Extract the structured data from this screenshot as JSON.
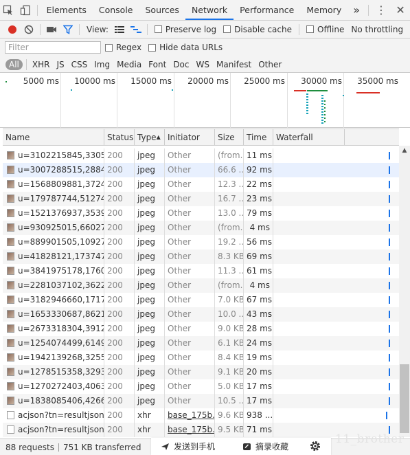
{
  "tabs": [
    "Elements",
    "Console",
    "Sources",
    "Network",
    "Performance",
    "Memory"
  ],
  "active_tab": "Network",
  "more_tabs": "»",
  "toolbar": {
    "view_label": "View:",
    "preserve_log": "Preserve log",
    "disable_cache": "Disable cache",
    "offline": "Offline",
    "throttling": "No throttling"
  },
  "filter": {
    "placeholder": "Filter",
    "regex": "Regex",
    "hide_data_urls": "Hide data URLs"
  },
  "type_filters": [
    "All",
    "XHR",
    "JS",
    "CSS",
    "Img",
    "Media",
    "Font",
    "Doc",
    "WS",
    "Manifest",
    "Other"
  ],
  "timeline_labels": [
    "5000 ms",
    "10000 ms",
    "15000 ms",
    "20000 ms",
    "25000 ms",
    "30000 ms",
    "35000 ms"
  ],
  "columns": {
    "name": "Name",
    "status": "Status",
    "type": "Type",
    "initiator": "Initiator",
    "size": "Size",
    "time": "Time",
    "waterfall": "Waterfall"
  },
  "rows": [
    {
      "name": "u=3102215845,3305...",
      "status": "200",
      "type": "jpeg",
      "initiator": "Other",
      "size": "(from...",
      "time": "11 ms"
    },
    {
      "name": "u=3007288515,2884...",
      "status": "200",
      "type": "jpeg",
      "initiator": "Other",
      "size": "66.6 ...",
      "time": "92 ms"
    },
    {
      "name": "u=1568809881,3724...",
      "status": "200",
      "type": "jpeg",
      "initiator": "Other",
      "size": "12.3 ...",
      "time": "22 ms"
    },
    {
      "name": "u=179787744,51274...",
      "status": "200",
      "type": "jpeg",
      "initiator": "Other",
      "size": "16.7 ...",
      "time": "23 ms"
    },
    {
      "name": "u=1521376937,3539...",
      "status": "200",
      "type": "jpeg",
      "initiator": "Other",
      "size": "13.0 ...",
      "time": "79 ms"
    },
    {
      "name": "u=930925015,66027...",
      "status": "200",
      "type": "jpeg",
      "initiator": "Other",
      "size": "(from...",
      "time": "4 ms"
    },
    {
      "name": "u=889901505,10927...",
      "status": "200",
      "type": "jpeg",
      "initiator": "Other",
      "size": "19.2 ...",
      "time": "56 ms"
    },
    {
      "name": "u=41828121,173747...",
      "status": "200",
      "type": "jpeg",
      "initiator": "Other",
      "size": "8.3 KB",
      "time": "69 ms"
    },
    {
      "name": "u=3841975178,1760...",
      "status": "200",
      "type": "jpeg",
      "initiator": "Other",
      "size": "11.3 ...",
      "time": "61 ms"
    },
    {
      "name": "u=2281037102,3622...",
      "status": "200",
      "type": "jpeg",
      "initiator": "Other",
      "size": "(from...",
      "time": "4 ms"
    },
    {
      "name": "u=3182946660,1717...",
      "status": "200",
      "type": "jpeg",
      "initiator": "Other",
      "size": "7.0 KB",
      "time": "67 ms"
    },
    {
      "name": "u=1653330687,8621...",
      "status": "200",
      "type": "jpeg",
      "initiator": "Other",
      "size": "10.0 ...",
      "time": "43 ms"
    },
    {
      "name": "u=2673318304,3912...",
      "status": "200",
      "type": "jpeg",
      "initiator": "Other",
      "size": "9.0 KB",
      "time": "28 ms"
    },
    {
      "name": "u=1254074499,6149...",
      "status": "200",
      "type": "jpeg",
      "initiator": "Other",
      "size": "6.1 KB",
      "time": "24 ms"
    },
    {
      "name": "u=1942139268,3255...",
      "status": "200",
      "type": "jpeg",
      "initiator": "Other",
      "size": "8.4 KB",
      "time": "19 ms"
    },
    {
      "name": "u=1278515358,3293...",
      "status": "200",
      "type": "jpeg",
      "initiator": "Other",
      "size": "9.1 KB",
      "time": "20 ms"
    },
    {
      "name": "u=1270272403,4063...",
      "status": "200",
      "type": "jpeg",
      "initiator": "Other",
      "size": "5.0 KB",
      "time": "17 ms"
    },
    {
      "name": "u=1838085406,4266...",
      "status": "200",
      "type": "jpeg",
      "initiator": "Other",
      "size": "10.5 ...",
      "time": "17 ms"
    },
    {
      "name": "acjson?tn=resultjson...",
      "status": "200",
      "type": "xhr",
      "initiator": "base_175b...",
      "size": "9.6 KB",
      "time": "938 ..."
    },
    {
      "name": "acjson?tn=resultjson...",
      "status": "200",
      "type": "xhr",
      "initiator": "base_175b...",
      "size": "9.5 KB",
      "time": "71 ms"
    }
  ],
  "status_bar": {
    "requests": "88 requests",
    "transferred": "751 KB transferred"
  },
  "overlay": {
    "send_to_phone": "发送到手机",
    "save_excerpt": "摘录收藏"
  },
  "watermark": "11_brother",
  "colors": {
    "accent": "#1a73e8",
    "record": "#d93025",
    "overview_green": "#1e8e3e",
    "overview_teal": "#17a2b8",
    "overview_red": "#d93025"
  }
}
